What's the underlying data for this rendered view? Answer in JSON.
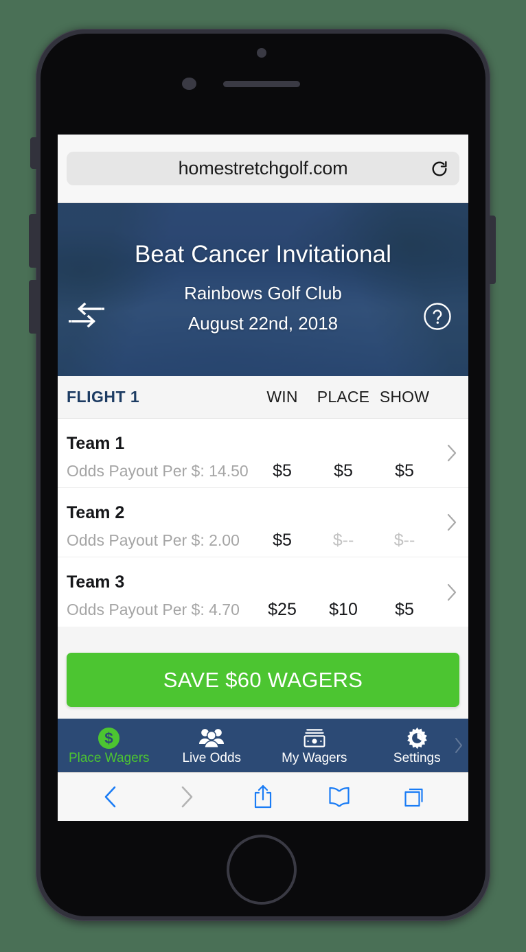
{
  "browser": {
    "url": "homestretchgolf.com",
    "reload_icon": "reload-icon",
    "toolbar": {
      "back": "back-icon",
      "forward": "forward-icon",
      "share": "share-icon",
      "bookmarks": "bookmarks-icon",
      "tabs": "tabs-icon"
    }
  },
  "hero": {
    "back_icon": "swap-arrows-icon",
    "help_icon": "help-circle-icon",
    "title": "Beat Cancer Invitational",
    "club": "Rainbows Golf Club",
    "date": "August 22nd, 2018"
  },
  "table": {
    "flight_label": "FLIGHT 1",
    "columns": [
      "WIN",
      "PLACE",
      "SHOW"
    ],
    "rows": [
      {
        "team": "Team 1",
        "odds": "Odds Payout Per $: 14.50",
        "win": "$5",
        "place": "$5",
        "show": "$5",
        "win_empty": false,
        "place_empty": false,
        "show_empty": false
      },
      {
        "team": "Team 2",
        "odds": "Odds Payout Per $: 2.00",
        "win": "$5",
        "place": "$--",
        "show": "$--",
        "win_empty": false,
        "place_empty": true,
        "show_empty": true
      },
      {
        "team": "Team 3",
        "odds": "Odds Payout Per $: 4.70",
        "win": "$25",
        "place": "$10",
        "show": "$5",
        "win_empty": false,
        "place_empty": false,
        "show_empty": false
      }
    ]
  },
  "save_button": {
    "label": "SAVE $60 WAGERS",
    "color": "#4CC531"
  },
  "tabbar": {
    "background": "#2c4a75",
    "active_color": "#4CC531",
    "items": [
      {
        "label": "Place Wagers",
        "icon": "dollar-circle-icon",
        "active": true
      },
      {
        "label": "Live Odds",
        "icon": "people-icon",
        "active": false
      },
      {
        "label": "My Wagers",
        "icon": "money-stack-icon",
        "active": false
      },
      {
        "label": "Settings",
        "icon": "gear-icon",
        "active": false
      }
    ],
    "more_icon": "chevron-right-icon"
  },
  "colors": {
    "navy": "#2c4a75",
    "flight_navy": "#1d3c63",
    "green": "#4CC531",
    "muted": "#a5a5a5",
    "empty": "#c3c3c3"
  }
}
